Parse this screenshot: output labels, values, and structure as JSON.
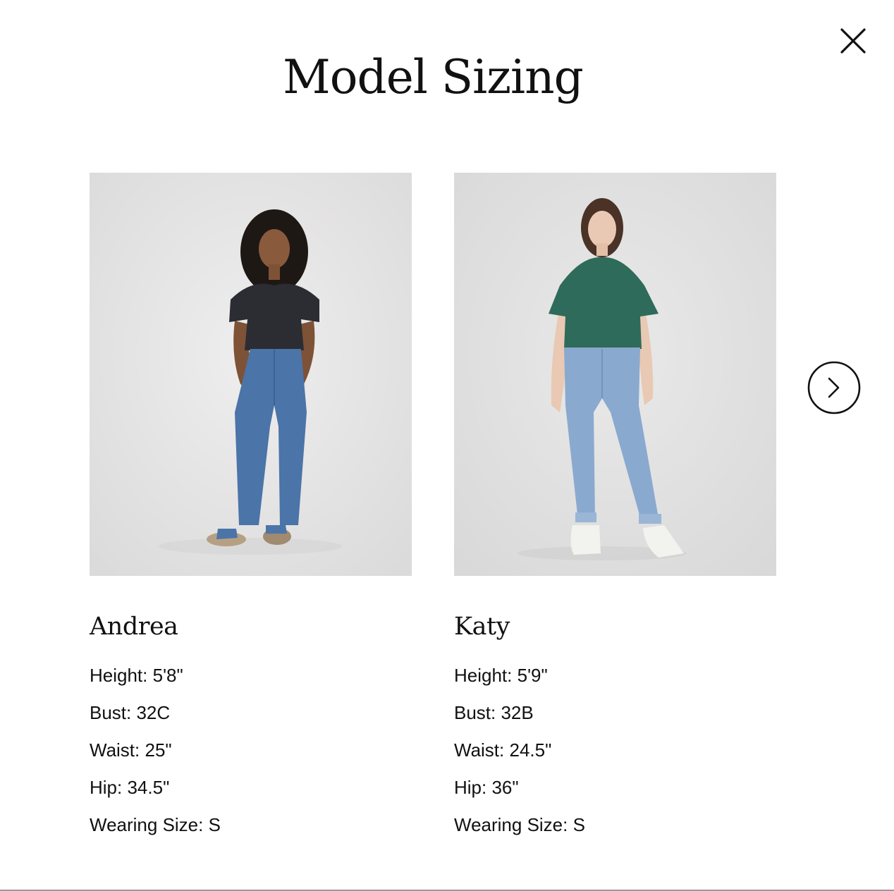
{
  "modal": {
    "title": "Model Sizing"
  },
  "icons": {
    "close": "close-icon",
    "next": "chevron-right-icon"
  },
  "models": [
    {
      "name": "Andrea",
      "photo": "model-photo-andrea",
      "stats": {
        "height": "Height: 5'8\"",
        "bust": "Bust: 32C",
        "waist": "Waist: 25\"",
        "hip": "Hip: 34.5\"",
        "wearing_size": "Wearing Size: S"
      }
    },
    {
      "name": "Katy",
      "photo": "model-photo-katy",
      "stats": {
        "height": "Height: 5'9\"",
        "bust": "Bust: 32B",
        "waist": "Waist: 24.5\"",
        "hip": "Hip: 36\"",
        "wearing_size": "Wearing Size: S"
      }
    }
  ],
  "colors": {
    "photo_background": "#e7e6e6",
    "text": "#111111",
    "andrea_tee": "#2b2d33",
    "katy_tee": "#2f6b5a",
    "denim_dark": "#4b74a8",
    "denim_light": "#8aa9cf"
  }
}
